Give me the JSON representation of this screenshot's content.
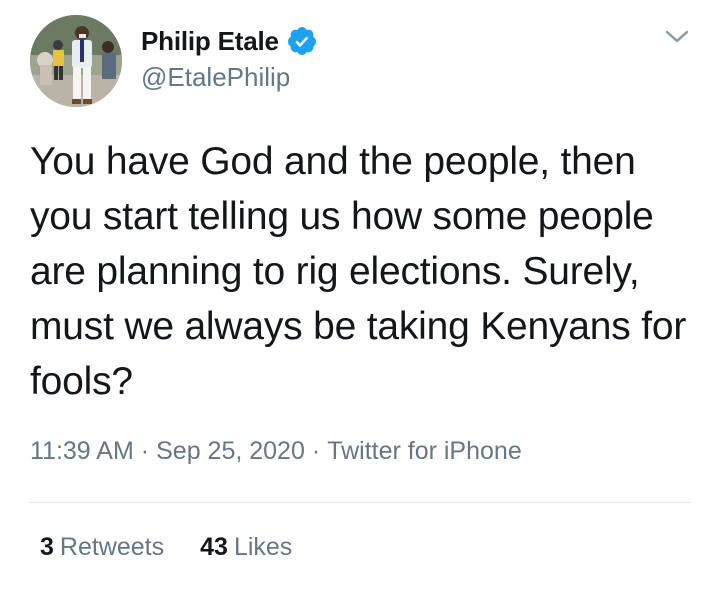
{
  "author": {
    "display_name": "Philip Etale",
    "handle": "@EtalePhilip",
    "verified": true,
    "avatar_icon": "profile-photo-person-outdoors"
  },
  "tweet": {
    "text": "You have God and the people, then you start telling us how some people are planning to rig elections. Surely, must we always be taking Kenyans for fools?",
    "time": "11:39 AM",
    "date": "Sep 25, 2020",
    "source": "Twitter for iPhone",
    "separator": "·"
  },
  "stats": {
    "retweets_count": "3",
    "retweets_label": "Retweets",
    "likes_count": "43",
    "likes_label": "Likes"
  },
  "colors": {
    "text": "#14171a",
    "secondary": "#657786",
    "verified": "#1da1f2",
    "divider": "#e1e8ed"
  },
  "icons": {
    "verified": "verified-badge-icon",
    "menu": "chevron-down-icon"
  }
}
